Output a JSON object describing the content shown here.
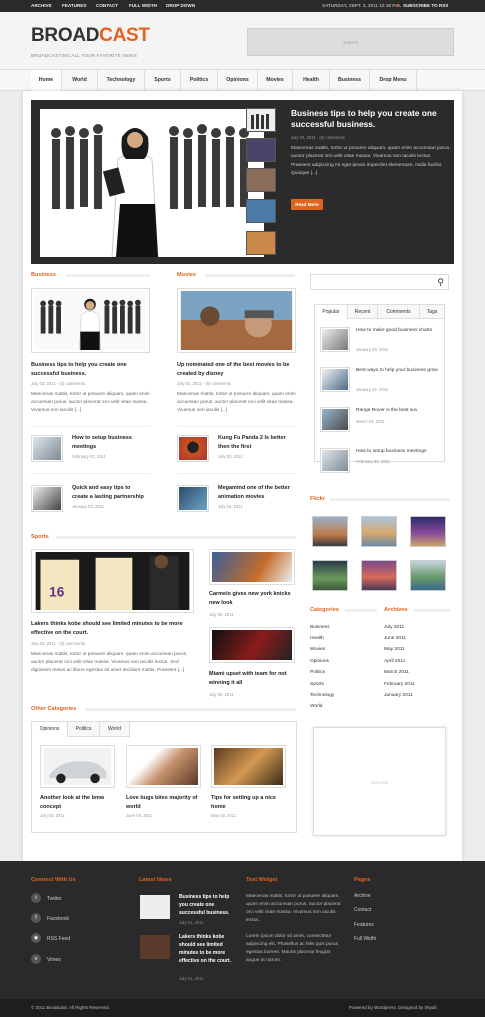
{
  "topbar": {
    "links": [
      "ARCHIVE",
      "FEATURES",
      "CONTACT",
      "FULL WIDTH",
      "DROP DOWN"
    ],
    "date": "SATURDAY, SEPT. 3, 2011  12:18 P.M.",
    "subscribe": "SUBSCRIBE TO RSS"
  },
  "header": {
    "logo_part1": "BROAD",
    "logo_part2": "CAST",
    "tagline": "BROADCASTING ALL YOUR FAVORITE NEWS",
    "ad_label": "468X60"
  },
  "nav": {
    "items": [
      "Home",
      "World",
      "Technology",
      "Sports",
      "Politics",
      "Opinions",
      "Movies",
      "Health",
      "Business",
      "Drop Menu"
    ]
  },
  "featured": {
    "title": "Business tips to help you create one successful business.",
    "date": "July 03, 2011 - (0) comments",
    "excerpt": "Maecenas mattis, tortor ut posuere aliquam, quam enim accumsan purus, auctor placerat orci velit vitae massa. Vivamus non iaculis lectus. Praesent adipiscing mi eget ipsum imperdiet elementum. Nulla facilisi. Quisque [...]",
    "read_more": "Read More"
  },
  "business": {
    "heading": "Business",
    "title": "Business tips to help you create one successful business.",
    "date": "July 03, 2011 - (0) comments",
    "excerpt": "Maecenas mattis, tortor ut posuere aliquam, quam enim accumsan purus, auctor placerat orci velit vitae massa. Vivamus non iaculis [...]",
    "small": [
      {
        "title": "How to setup business meetings",
        "date": "February 03, 2011"
      },
      {
        "title": "Quick and easy tips to create a lasting partnership",
        "date": "January 03, 2011"
      }
    ]
  },
  "movies": {
    "heading": "Movies",
    "title": "Up nominated one of the best movies to be created by disney",
    "date": "July 02, 2011 - (0) comments",
    "excerpt": "Maecenas mattis, tortor ut posuere aliquam, quam enim accumsan purus, auctor placerat orci velit vitae massa. Vivamus non iaculis [...]",
    "small": [
      {
        "title": "Kung Fu Panda 2 Is better then the first",
        "date": "July 02, 2011"
      },
      {
        "title": "Megamind one of the better animation movies",
        "date": "July 02, 2011"
      }
    ]
  },
  "sports": {
    "heading": "Sports",
    "title": "Lakers thinks kobe should see limited minutes to be more effective on the court.",
    "date": "July 03, 2011 - (0) comments",
    "excerpt": "Maecenas mattis, tortor ut posuere aliquam, quam enim accumsan purus, auctor placerat orci velit vitae massa. Vivamus non iaculis lectus. Sed dignissim metus ac libero egestas sit amet tincidunt mattis. Praesent [...]",
    "side": [
      {
        "title": "Carmelo gives new york knicks new look",
        "date": "July 02, 2011"
      },
      {
        "title": "Miami upset with team for not winning it all",
        "date": "July 02, 2011"
      }
    ]
  },
  "other": {
    "heading": "Other Categories",
    "tabs": [
      "Opinions",
      "Politics",
      "World"
    ],
    "items": [
      {
        "title": "Another look at the bmw concept",
        "date": "July 03, 2011"
      },
      {
        "title": "Love bugs bites majority of world",
        "date": "June 03, 2011"
      },
      {
        "title": "Tips for setting up a nice home",
        "date": "May 03, 2011"
      }
    ]
  },
  "sidebar": {
    "tabs": [
      "Popular",
      "Recent",
      "Comments",
      "Tags"
    ],
    "popular": [
      {
        "title": "How to make good business charts",
        "date": "January 03, 2011"
      },
      {
        "title": "Best ways to help your business grow",
        "date": "January 02, 2011"
      },
      {
        "title": "Range Rover is the best suv",
        "date": "March 03, 2011"
      },
      {
        "title": "How to setup business meetings",
        "date": "February 03, 2011"
      }
    ],
    "flickr_heading": "Flickr",
    "categories_heading": "Categories",
    "categories": [
      "Business",
      "Health",
      "Movies",
      "Opinions",
      "Politics",
      "Sports",
      "Technology",
      "World"
    ],
    "archives_heading": "Archives",
    "archives": [
      "July 2011",
      "June 2011",
      "May 2011",
      "April 2011",
      "March 2011",
      "February 2011",
      "January 2011"
    ],
    "ad_label": "300x250"
  },
  "footer": {
    "connect_heading": "Connect With Us",
    "connect": [
      "Twitter",
      "Facebook",
      "RSS Feed",
      "Vimeo"
    ],
    "news_heading": "Latest News",
    "news": [
      {
        "title": "Business tips to help you create one successful business.",
        "date": "July 03, 2011"
      },
      {
        "title": "Lakers thinks kobe should see limited minutes to be more effective on the court.",
        "date": "July 03, 2011"
      }
    ],
    "widget_heading": "Text Widget",
    "widget_text1": "Maecenas mattis, tortor ut posuere aliquam, quam enim accumsan purus, auctor placerat orci velit vitae massa. Vivamus non iaculis lectus.",
    "widget_text2": "Lorem ipsum dolor sit amet, consectetur adipiscing elit. Phasellus ac felis quis purus egestas laoreet. Mauris placerat feugiat augue at rutrum.",
    "pages_heading": "Pages",
    "pages": [
      "Archive",
      "Contact",
      "Features",
      "Full Width"
    ]
  },
  "bottom": {
    "copyright": "© 2011 Broadcast. All Rights Reserved.",
    "credit": "Powered by Wordpress. Designed by Skyali"
  }
}
